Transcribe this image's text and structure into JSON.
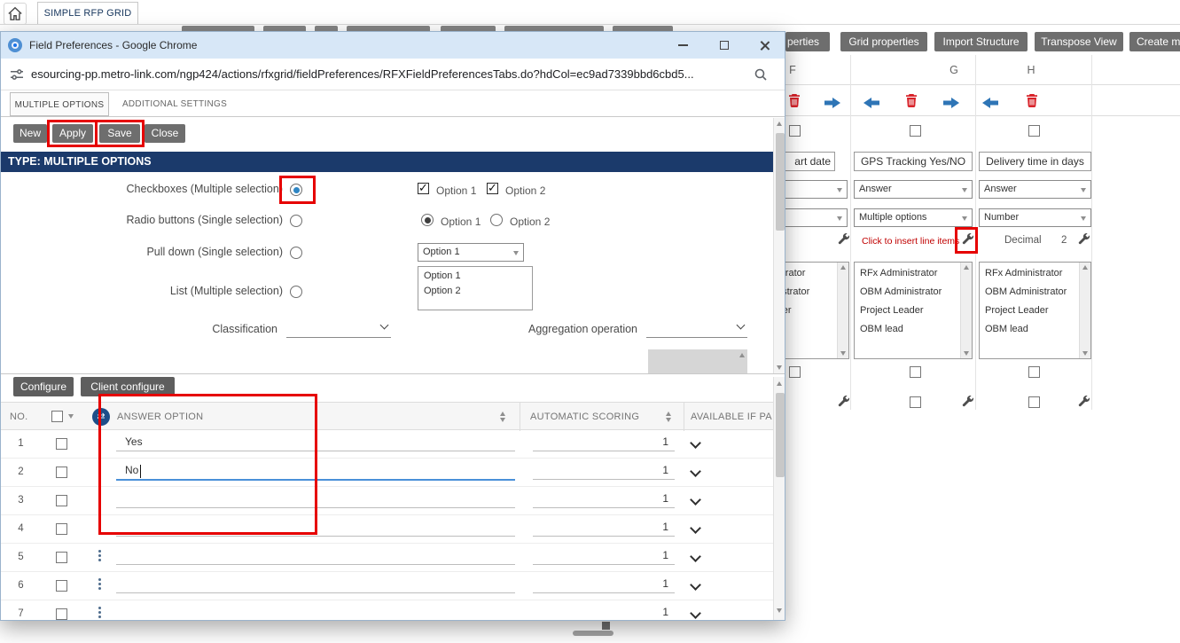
{
  "background": {
    "top_tab": "SIMPLE RFP GRID",
    "toolbar": {
      "partial_properties": "perties",
      "grid_properties": "Grid properties",
      "import_structure": "Import Structure",
      "transpose_view": "Transpose View",
      "create_partial": "Create m"
    },
    "grid": {
      "col_letters": [
        "F",
        "G",
        "H"
      ],
      "field_names": [
        "art date",
        "GPS Tracking Yes/NO",
        "Delivery time in days"
      ],
      "type_selects": [
        "Answer",
        "Answer"
      ],
      "subtype_selects": [
        "Multiple options",
        "Number"
      ],
      "insert_line_items": "Click to insert line items",
      "decimal_label": "Decimal",
      "decimal_value": "2",
      "roles": [
        "RFx Administrator",
        "OBM Administrator",
        "Project Leader",
        "OBM lead"
      ]
    }
  },
  "popup": {
    "title": "Field Preferences - Google Chrome",
    "url": "esourcing-pp.metro-link.com/ngp424/actions/rfxgrid/fieldPreferences/RFXFieldPreferencesTabs.do?hdCol=ec9ad7339bbd6cbd5...",
    "tabs": {
      "multiple_options": "MULTIPLE OPTIONS",
      "additional_settings": "ADDITIONAL SETTINGS"
    },
    "actions": {
      "new": "New",
      "apply": "Apply",
      "save": "Save",
      "close": "Close"
    },
    "section_title": "TYPE: MULTIPLE OPTIONS",
    "form": {
      "type_options": [
        "Checkboxes (Multiple selection)",
        "Radio buttons (Single selection)",
        "Pull down (Single selection)",
        "List (Multiple selection)"
      ],
      "option1": "Option 1",
      "option2": "Option 2",
      "pulldown_value": "Option 1",
      "list_values": [
        "Option 1",
        "Option 2"
      ],
      "classification_label": "Classification",
      "aggregation_label": "Aggregation operation"
    },
    "lower": {
      "configure": "Configure",
      "client_configure": "Client configure",
      "headers": {
        "no": "NO.",
        "answer_option": "ANSWER OPTION",
        "automatic_scoring": "AUTOMATIC SCORING",
        "available_if": "AVAILABLE IF PAR"
      },
      "rows": [
        {
          "no": "1",
          "answer": "Yes",
          "score": "1"
        },
        {
          "no": "2",
          "answer": "No",
          "score": "1"
        },
        {
          "no": "3",
          "answer": "",
          "score": "1"
        },
        {
          "no": "4",
          "answer": "",
          "score": "1"
        },
        {
          "no": "5",
          "answer": "",
          "score": "1"
        },
        {
          "no": "6",
          "answer": "",
          "score": "1"
        },
        {
          "no": "7",
          "answer": "",
          "score": "1"
        }
      ]
    }
  },
  "colors": {
    "annotation_red": "#e60000",
    "section_header_blue": "#1b3a6b",
    "button_gray": "#6e6e6e",
    "link_red": "#c00000",
    "focus_blue": "#4a90d9",
    "icon_navy": "#1d4e89"
  }
}
